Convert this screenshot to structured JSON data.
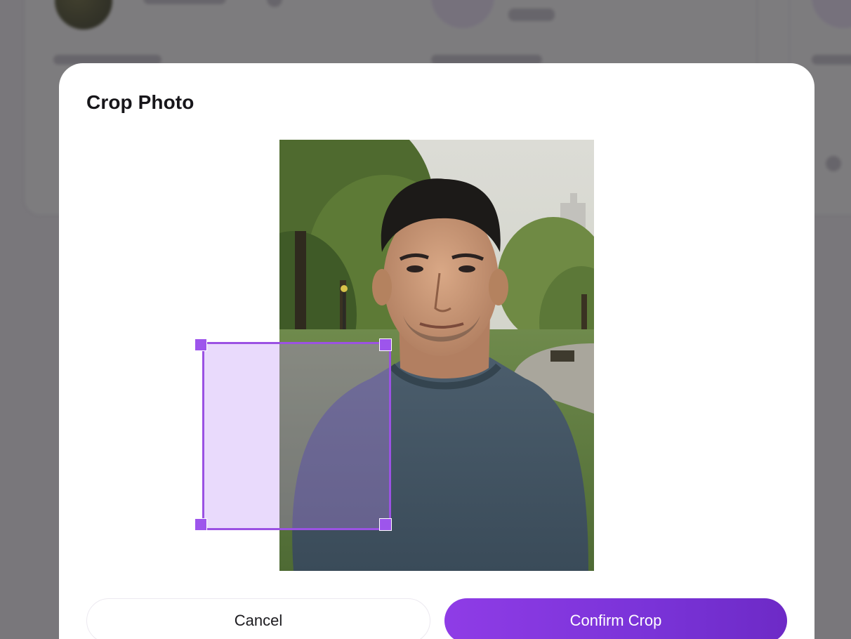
{
  "dialog": {
    "title": "Crop Photo",
    "cancel_label": "Cancel",
    "confirm_label": "Confirm Crop"
  },
  "crop": {
    "handles": [
      "top-left",
      "top-right",
      "bottom-left",
      "bottom-right"
    ]
  },
  "colors": {
    "accent": "#9b52e3",
    "confirm_gradient_start": "#8f3ce6",
    "confirm_gradient_end": "#6d2ac6",
    "overlay": "#262428"
  }
}
